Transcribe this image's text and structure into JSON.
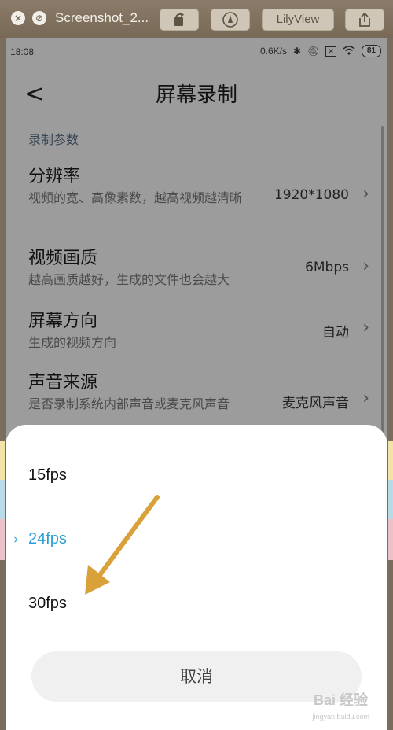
{
  "toolbar": {
    "title": "Screenshot_2...",
    "lilyview_label": "LilyView"
  },
  "status": {
    "time": "18:08",
    "speed": "0.6K/s",
    "battery": "81"
  },
  "header": {
    "back": "<",
    "title": "屏幕录制"
  },
  "section_label": "录制参数",
  "settings": [
    {
      "title": "分辨率",
      "subtitle": "视频的宽、高像素数，越高视频越清晰",
      "value": "1920*1080"
    },
    {
      "title": "视频画质",
      "subtitle": "越高画质越好，生成的文件也会越大",
      "value": "6Mbps"
    },
    {
      "title": "屏幕方向",
      "subtitle": "生成的视频方向",
      "value": "自动"
    },
    {
      "title": "声音来源",
      "subtitle": "是否录制系统内部声音或麦克风声音",
      "value": "麦克风声音"
    }
  ],
  "sheet": {
    "options": [
      {
        "label": "15fps",
        "selected": false
      },
      {
        "label": "24fps",
        "selected": true
      },
      {
        "label": "30fps",
        "selected": false
      }
    ],
    "cancel": "取消"
  },
  "colors": {
    "accent": "#2a9fd8",
    "annotation_arrow": "#d9a13a"
  },
  "watermark": {
    "brand": "Bai 经验",
    "url": "jingyan.baidu.com"
  }
}
